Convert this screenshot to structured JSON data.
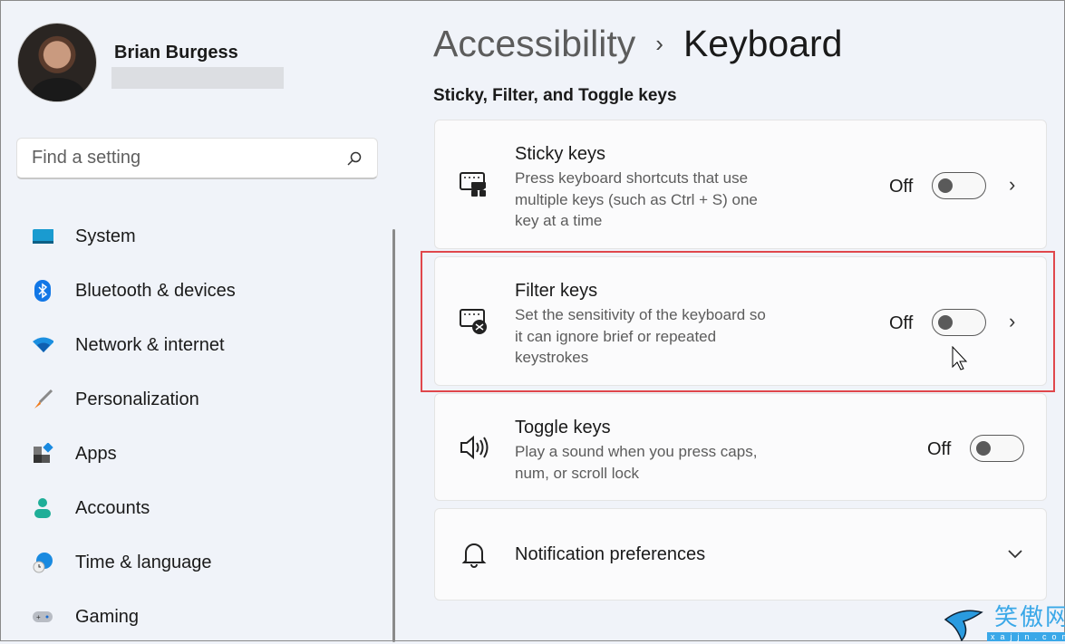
{
  "user": {
    "name": "Brian Burgess"
  },
  "search": {
    "placeholder": "Find a setting",
    "icon": "search-icon"
  },
  "sidebar": {
    "items": [
      {
        "label": "System",
        "icon": "monitor-icon"
      },
      {
        "label": "Bluetooth & devices",
        "icon": "bluetooth-icon"
      },
      {
        "label": "Network & internet",
        "icon": "wifi-icon"
      },
      {
        "label": "Personalization",
        "icon": "brush-icon"
      },
      {
        "label": "Apps",
        "icon": "apps-icon"
      },
      {
        "label": "Accounts",
        "icon": "person-icon"
      },
      {
        "label": "Time & language",
        "icon": "globe-clock-icon"
      },
      {
        "label": "Gaming",
        "icon": "gamepad-icon"
      }
    ]
  },
  "breadcrumb": {
    "parent": "Accessibility",
    "separator": "›",
    "current": "Keyboard"
  },
  "section_title": "Sticky, Filter, and Toggle keys",
  "cards": [
    {
      "title": "Sticky keys",
      "desc": "Press keyboard shortcuts that use multiple keys (such as Ctrl + S) one key at a time",
      "state": "Off",
      "on": false,
      "icon": "sticky-keys-icon"
    },
    {
      "title": "Filter keys",
      "desc": "Set the sensitivity of the keyboard so it can ignore brief or repeated keystrokes",
      "state": "Off",
      "on": false,
      "icon": "filter-keys-icon"
    },
    {
      "title": "Toggle keys",
      "desc": "Play a sound when you press caps, num, or scroll lock",
      "state": "Off",
      "on": false,
      "icon": "speaker-icon"
    }
  ],
  "notification": {
    "title": "Notification preferences",
    "icon": "bell-icon"
  },
  "highlight_color": "#e0474c",
  "watermark": {
    "text": "笑傲网",
    "site": "xajjn.com"
  }
}
